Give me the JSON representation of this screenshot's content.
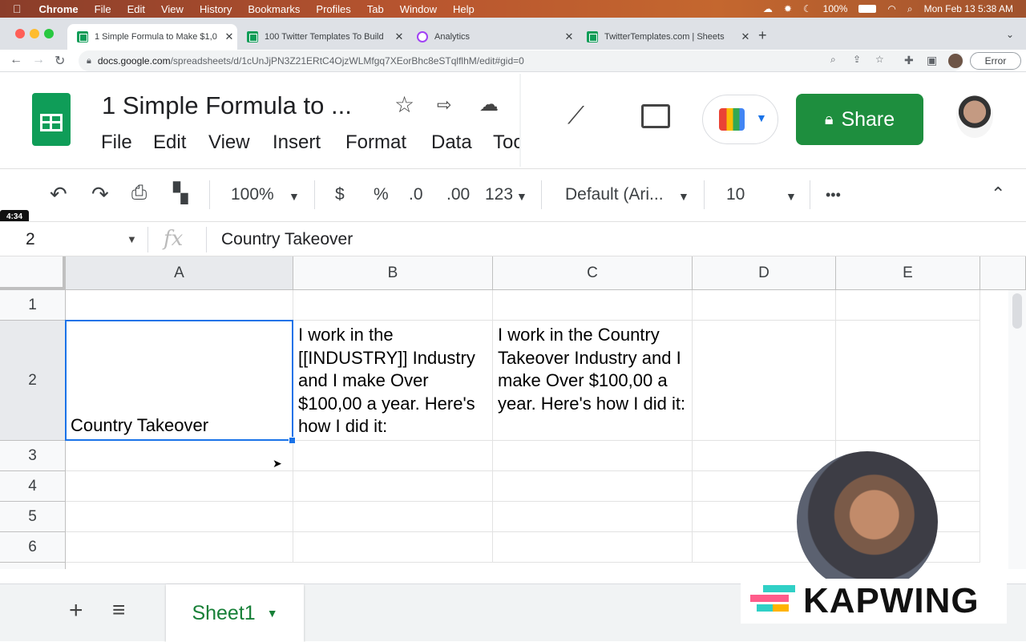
{
  "menubar": {
    "app": "Chrome",
    "items": [
      "File",
      "Edit",
      "View",
      "History",
      "Bookmarks",
      "Profiles",
      "Tab",
      "Window",
      "Help"
    ],
    "battery": "100%",
    "clock": "Mon Feb 13  5:38 AM"
  },
  "tabs": [
    {
      "title": "1 Simple Formula to Make $1,0",
      "icon": "sheets-icon",
      "active": true
    },
    {
      "title": "100 Twitter Templates To Build",
      "icon": "sheets-icon",
      "active": false
    },
    {
      "title": "Analytics",
      "icon": "analytics-icon",
      "active": false
    },
    {
      "title": "TwitterTemplates.com | Sheets",
      "icon": "sheets-icon",
      "active": false
    }
  ],
  "address": {
    "host": "docs.google.com",
    "path": "/spreadsheets/d/1cUnJjPN3Z21ERtC4OjzWLMfgq7XEorBhc8eSTqlflhM/edit#gid=0",
    "error_label": "Error"
  },
  "doc": {
    "title": "1 Simple Formula to ...",
    "menus": [
      "File",
      "Edit",
      "View",
      "Insert",
      "Format",
      "Data",
      "Too"
    ],
    "share_label": "Share"
  },
  "toolbar": {
    "zoom": "100%",
    "currency": "$",
    "percent": "%",
    "dec_less": ".0",
    "dec_more": ".00",
    "format_123": "123",
    "font": "Default (Ari...",
    "font_size": "10",
    "more": "•••"
  },
  "recorder": {
    "time": "4:34"
  },
  "formula_bar": {
    "cell_ref": "2",
    "fx": "fx",
    "content": "Country Takeover"
  },
  "grid": {
    "columns": [
      "A",
      "B",
      "C",
      "D",
      "E"
    ],
    "rows": [
      "1",
      "2",
      "3",
      "4",
      "5",
      "6"
    ],
    "a2": "Country Takeover",
    "b2": "I work in the [[INDUSTRY]] Industry and I make Over $100,00 a year. Here's how I did it:",
    "c2": "I work in the Country Takeover Industry and I make Over $100,00 a year. Here's how I did it:"
  },
  "sheets": {
    "add": "+",
    "list": "≡",
    "active": "Sheet1"
  },
  "watermark": {
    "brand": "KAPWING"
  }
}
